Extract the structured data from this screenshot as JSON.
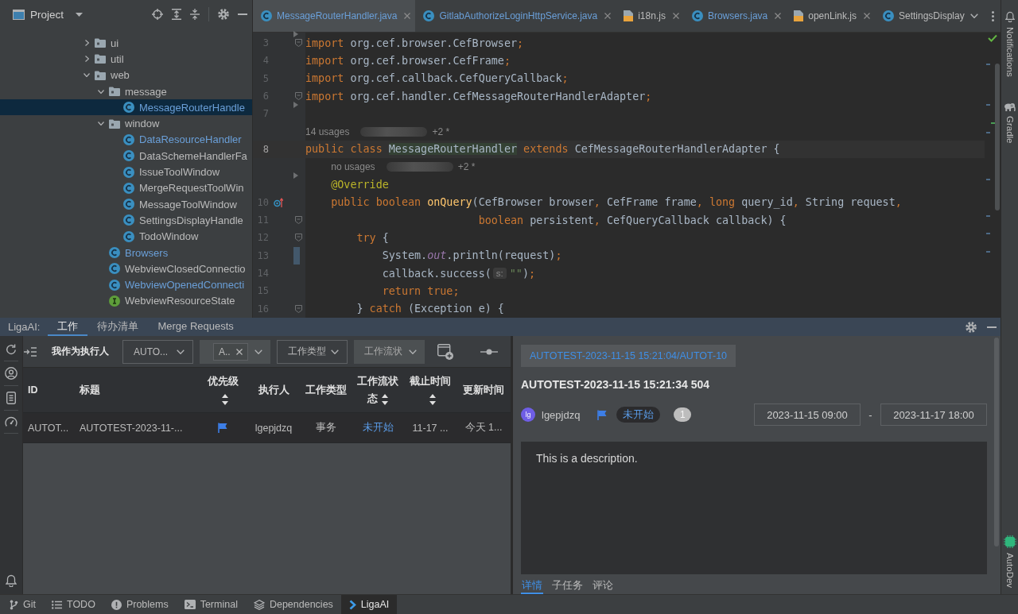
{
  "project": {
    "title": "Project",
    "tree": [
      {
        "label": "ui",
        "kind": "package",
        "expanded": false,
        "selected": false,
        "modified": false
      },
      {
        "label": "util",
        "kind": "package",
        "expanded": false,
        "selected": false,
        "modified": false
      },
      {
        "label": "web",
        "kind": "package",
        "expanded": true,
        "selected": false,
        "modified": false,
        "children": [
          {
            "label": "message",
            "kind": "package",
            "expanded": true,
            "selected": false,
            "modified": false,
            "children": [
              {
                "label": "MessageRouterHandle",
                "kind": "class",
                "selected": true,
                "modified": true
              }
            ]
          },
          {
            "label": "window",
            "kind": "package",
            "expanded": true,
            "selected": false,
            "modified": false,
            "children": [
              {
                "label": "DataResourceHandler",
                "kind": "class",
                "selected": false,
                "modified": true
              },
              {
                "label": "DataSchemeHandlerFa",
                "kind": "class",
                "selected": false,
                "modified": false
              },
              {
                "label": "IssueToolWindow",
                "kind": "class",
                "selected": false,
                "modified": false
              },
              {
                "label": "MergeRequestToolWin",
                "kind": "class",
                "selected": false,
                "modified": false
              },
              {
                "label": "MessageToolWindow",
                "kind": "class",
                "selected": false,
                "modified": false
              },
              {
                "label": "SettingsDisplayHandle",
                "kind": "class",
                "selected": false,
                "modified": false
              },
              {
                "label": "TodoWindow",
                "kind": "class",
                "selected": false,
                "modified": false
              }
            ]
          },
          {
            "label": "Browsers",
            "kind": "class",
            "selected": false,
            "modified": true
          },
          {
            "label": "WebviewClosedConnectio",
            "kind": "class",
            "selected": false,
            "modified": false
          },
          {
            "label": "WebviewOpenedConnecti",
            "kind": "class",
            "selected": false,
            "modified": true
          },
          {
            "label": "WebviewResourceState",
            "kind": "interface",
            "selected": false,
            "modified": false
          }
        ]
      }
    ]
  },
  "editor": {
    "tabs": [
      {
        "label": "MessageRouterHandler.java",
        "kind": "java",
        "selected": true,
        "modified": true,
        "closable": true
      },
      {
        "label": "GitlabAuthorizeLoginHttpService.java",
        "kind": "java",
        "selected": false,
        "modified": true,
        "closable": true
      },
      {
        "label": "i18n.js",
        "kind": "js",
        "selected": false,
        "modified": false,
        "closable": true
      },
      {
        "label": "Browsers.java",
        "kind": "java",
        "selected": false,
        "modified": true,
        "closable": true
      },
      {
        "label": "openLink.js",
        "kind": "js",
        "selected": false,
        "modified": false,
        "closable": true
      },
      {
        "label": "SettingsDisplay",
        "kind": "java",
        "selected": false,
        "modified": false,
        "closable": false
      }
    ],
    "inspection_ok": true,
    "lines": [
      {
        "kind": "code",
        "number": "3",
        "current": false,
        "fold": true,
        "arrow": true,
        "override": false,
        "changed": false,
        "tokens": [
          {
            "kind": "keyword",
            "text": "import"
          },
          {
            "kind": "plain",
            "text": " org.cef.browser.CefBrowser"
          },
          {
            "kind": "punct",
            "text": ";"
          }
        ]
      },
      {
        "kind": "code",
        "number": "4",
        "current": false,
        "fold": false,
        "arrow": false,
        "override": false,
        "changed": false,
        "tokens": [
          {
            "kind": "keyword",
            "text": "import"
          },
          {
            "kind": "plain",
            "text": " org.cef.browser.CefFrame"
          },
          {
            "kind": "punct",
            "text": ";"
          }
        ]
      },
      {
        "kind": "code",
        "number": "5",
        "current": false,
        "fold": false,
        "arrow": false,
        "override": false,
        "changed": false,
        "tokens": [
          {
            "kind": "keyword",
            "text": "import"
          },
          {
            "kind": "plain",
            "text": " org.cef.callback.CefQueryCallback"
          },
          {
            "kind": "punct",
            "text": ";"
          }
        ]
      },
      {
        "kind": "code",
        "number": "6",
        "current": false,
        "fold": true,
        "arrow": false,
        "override": false,
        "changed": false,
        "tokens": [
          {
            "kind": "keyword",
            "text": "import"
          },
          {
            "kind": "plain",
            "text": " org.cef.handler.CefMessageRouterHandlerAdapter"
          },
          {
            "kind": "punct",
            "text": ";"
          }
        ]
      },
      {
        "kind": "code",
        "number": "7",
        "current": false,
        "fold": false,
        "arrow": true,
        "override": false,
        "changed": false
      },
      {
        "kind": "inlay",
        "text": "14 usages",
        "redacted": true,
        "suffix": "+2 *"
      },
      {
        "kind": "code",
        "number": "8",
        "current": true,
        "fold": false,
        "arrow": false,
        "override": false,
        "changed": false,
        "tokens": [
          {
            "kind": "keyword",
            "text": "public class "
          },
          {
            "kind": "match",
            "text": "MessageRouterHandler"
          },
          {
            "kind": "keyword",
            "text": " extends "
          },
          {
            "kind": "plain",
            "text": "CefMessageRouterHandlerAdapter {"
          }
        ]
      },
      {
        "kind": "inlay",
        "text": "no usages",
        "redacted": true,
        "suffix": "+2 *"
      },
      {
        "kind": "code",
        "current": false,
        "fold": false,
        "arrow": true,
        "override": false,
        "changed": false,
        "tokens": [
          {
            "kind": "annotation",
            "text": "    @Override"
          }
        ]
      },
      {
        "kind": "code",
        "number": "10",
        "current": false,
        "fold": false,
        "arrow": false,
        "override": true,
        "changed": false,
        "tokens": [
          {
            "kind": "keyword",
            "text": "    public boolean "
          },
          {
            "kind": "method",
            "text": "onQuery"
          },
          {
            "kind": "plain",
            "text": "(CefBrowser browser"
          },
          {
            "kind": "punct",
            "text": ", "
          },
          {
            "kind": "plain",
            "text": "CefFrame frame"
          },
          {
            "kind": "punct",
            "text": ", "
          },
          {
            "kind": "keyword",
            "text": "long "
          },
          {
            "kind": "plain",
            "text": "query_id"
          },
          {
            "kind": "punct",
            "text": ", "
          },
          {
            "kind": "plain",
            "text": "String request"
          },
          {
            "kind": "punct",
            "text": ","
          }
        ]
      },
      {
        "kind": "code",
        "number": "11",
        "current": false,
        "fold": true,
        "arrow": false,
        "override": false,
        "changed": false,
        "tokens": [
          {
            "kind": "keyword",
            "text": "                           boolean "
          },
          {
            "kind": "plain",
            "text": "persistent"
          },
          {
            "kind": "punct",
            "text": ", "
          },
          {
            "kind": "plain",
            "text": "CefQueryCallback callback) {"
          }
        ]
      },
      {
        "kind": "code",
        "number": "12",
        "current": false,
        "fold": true,
        "arrow": false,
        "override": false,
        "changed": false,
        "tokens": [
          {
            "kind": "keyword",
            "text": "        try "
          },
          {
            "kind": "plain",
            "text": "{"
          }
        ]
      },
      {
        "kind": "code",
        "number": "13",
        "current": false,
        "fold": false,
        "arrow": false,
        "override": false,
        "changed": true,
        "tokens": [
          {
            "kind": "plain",
            "text": "            System."
          },
          {
            "kind": "static",
            "text": "out"
          },
          {
            "kind": "plain",
            "text": ".println(request)"
          },
          {
            "kind": "punct",
            "text": ";"
          }
        ]
      },
      {
        "kind": "code",
        "number": "14",
        "current": false,
        "fold": false,
        "arrow": false,
        "override": false,
        "changed": false,
        "tokens": [
          {
            "kind": "plain",
            "text": "            callback.success("
          },
          {
            "kind": "hint",
            "text": "s:"
          },
          {
            "kind": "string",
            "text": "\"\""
          },
          {
            "kind": "plain",
            "text": ")"
          },
          {
            "kind": "punct",
            "text": ";"
          }
        ]
      },
      {
        "kind": "code",
        "number": "15",
        "current": false,
        "fold": false,
        "arrow": false,
        "override": false,
        "changed": false,
        "tokens": [
          {
            "kind": "keyword",
            "text": "            return true"
          },
          {
            "kind": "punct",
            "text": ";"
          }
        ]
      },
      {
        "kind": "code",
        "number": "16",
        "current": false,
        "fold": true,
        "arrow": false,
        "override": false,
        "changed": false,
        "tokens": [
          {
            "kind": "plain",
            "text": "        } "
          },
          {
            "kind": "keyword",
            "text": "catch "
          },
          {
            "kind": "plain",
            "text": "(Exception e) {"
          }
        ]
      }
    ]
  },
  "tool_window": {
    "title": "LigaAI:",
    "tabs": [
      {
        "label": "工作",
        "selected": true
      },
      {
        "label": "待办清单",
        "selected": false
      },
      {
        "label": "Merge Requests",
        "selected": false
      }
    ],
    "toolbar": {
      "assignee_filter": "我作为执行人",
      "filters": [
        {
          "kind": "outlined",
          "value": "AUTO..."
        },
        {
          "kind": "tags",
          "tags": [
            {
              "label": "A.."
            }
          ]
        },
        {
          "kind": "outlined",
          "value": "工作类型"
        },
        {
          "kind": "filled",
          "value": "工作流状"
        }
      ]
    },
    "table": {
      "columns": [
        {
          "label": "ID",
          "sortable": false
        },
        {
          "label": "标题",
          "sortable": false
        },
        {
          "label": "优先级",
          "sortable": true
        },
        {
          "label": "执行人",
          "sortable": false
        },
        {
          "label": "工作类型",
          "sortable": false
        },
        {
          "label": "工作流状态",
          "sortable": true
        },
        {
          "label": "截止时间",
          "sortable": true
        },
        {
          "label": "更新时间",
          "sortable": false
        }
      ],
      "rows": [
        {
          "selected": false,
          "cells": [
            {
              "kind": "text",
              "text": "AUTOT..."
            },
            {
              "kind": "text",
              "text": "AUTOTEST-2023-11-..."
            },
            {
              "kind": "flag"
            },
            {
              "kind": "text",
              "text": "lgepjdzq"
            },
            {
              "kind": "text",
              "text": "事务"
            },
            {
              "kind": "status",
              "text": "未开始"
            },
            {
              "kind": "text",
              "text": "11-17 ..."
            },
            {
              "kind": "text",
              "text": "今天 1..."
            }
          ]
        }
      ]
    },
    "detail": {
      "breadcrumb": "AUTOTEST-2023-11-15 15:21:04/AUTOT-10",
      "title": "AUTOTEST-2023-11-15 15:21:34 504",
      "assignee": {
        "initials": "lg",
        "name": "lgepjdzq"
      },
      "status": "未开始",
      "count_badge": "1",
      "start": "2023-11-15 09:00",
      "range_separator": "-",
      "end": "2023-11-17 18:00",
      "description": "This is a description.",
      "tabs": [
        {
          "label": "详情",
          "selected": true
        },
        {
          "label": "子任务",
          "selected": false
        },
        {
          "label": "评论",
          "selected": false
        }
      ]
    }
  },
  "side_strip": {
    "top": [
      {
        "label": "Notifications",
        "kind": "bell"
      },
      {
        "label": "Gradle",
        "kind": "elephant"
      }
    ],
    "bottom": [
      {
        "label": "AutoDev",
        "kind": "chip"
      }
    ]
  },
  "status_bar": {
    "items": [
      {
        "label": "Git",
        "kind": "branch",
        "selected": false
      },
      {
        "label": "TODO",
        "kind": "list",
        "selected": false
      },
      {
        "label": "Problems",
        "kind": "problems",
        "selected": false
      },
      {
        "label": "Terminal",
        "kind": "terminal",
        "selected": false
      },
      {
        "label": "Dependencies",
        "kind": "layers",
        "selected": false
      },
      {
        "label": "LigaAI",
        "kind": "chevron",
        "selected": true
      }
    ]
  }
}
